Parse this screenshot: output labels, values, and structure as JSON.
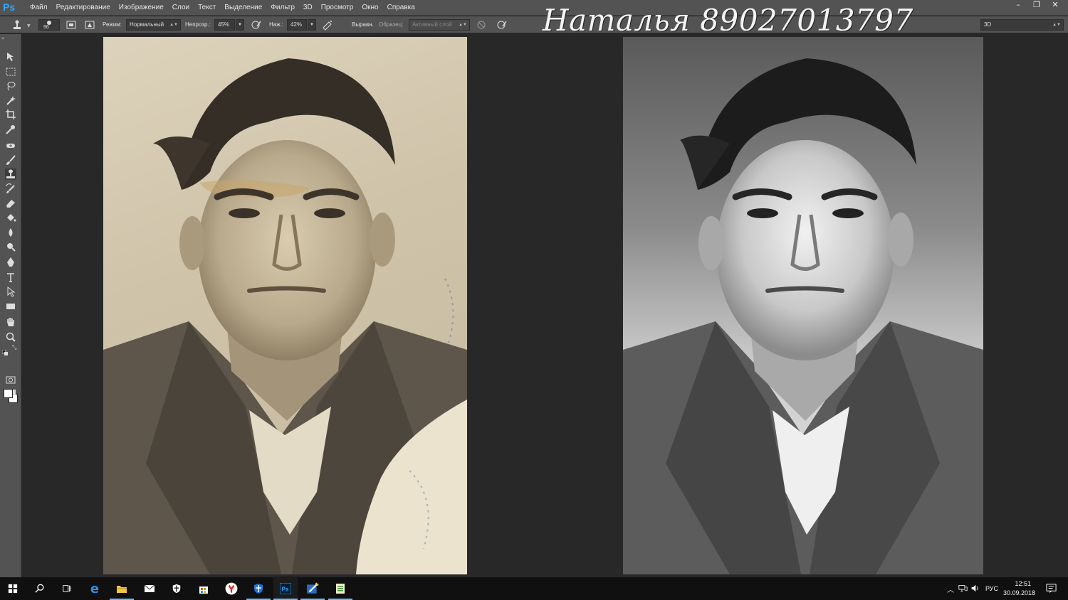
{
  "app": {
    "logo": "Ps"
  },
  "menu": [
    "Файл",
    "Редактирование",
    "Изображение",
    "Слои",
    "Текст",
    "Выделение",
    "Фильтр",
    "3D",
    "Просмотр",
    "Окно",
    "Справка"
  ],
  "window_controls": {
    "minimize": "–",
    "restore": "❐",
    "close": "✕"
  },
  "signature": "Наталья 89027013797",
  "options": {
    "brush_size": "96",
    "mode_label": "Режим:",
    "mode_value": "Нормальный",
    "opacity_label": "Непрозр.:",
    "opacity_value": "45%",
    "flow_label": "Наж.:",
    "flow_value": "42%",
    "aligned_label": "Выравн.",
    "aligned_checked": true,
    "sample_label": "Образец:",
    "sample_value": "Активный слой",
    "workspace_value": "3D"
  },
  "tools": [
    "move-tool-icon",
    "rect-marquee-icon",
    "lasso-icon",
    "magic-wand-icon",
    "crop-icon",
    "eyedropper-icon",
    "spot-healing-icon",
    "brush-icon",
    "clone-stamp-icon",
    "history-brush-icon",
    "eraser-icon",
    "paint-bucket-icon",
    "blur-icon",
    "dodge-icon",
    "pen-icon",
    "type-icon",
    "path-selection-icon",
    "rectangle-icon",
    "hand-icon",
    "zoom-icon"
  ],
  "colors": {
    "foreground": "#ffffff",
    "background": "#ffffff",
    "accent": "#31a8ff"
  },
  "taskbar": {
    "apps": [
      "windows-start-icon",
      "search-icon",
      "task-view-icon",
      "edge-icon",
      "file-explorer-icon",
      "mail-icon",
      "defender-icon",
      "store-icon",
      "yandex-browser-icon",
      "security-shield-icon",
      "photoshop-icon",
      "editor-icon",
      "notes-icon"
    ],
    "tray": {
      "language": "РУС",
      "time": "12:51",
      "date": "30.09.2018"
    }
  }
}
